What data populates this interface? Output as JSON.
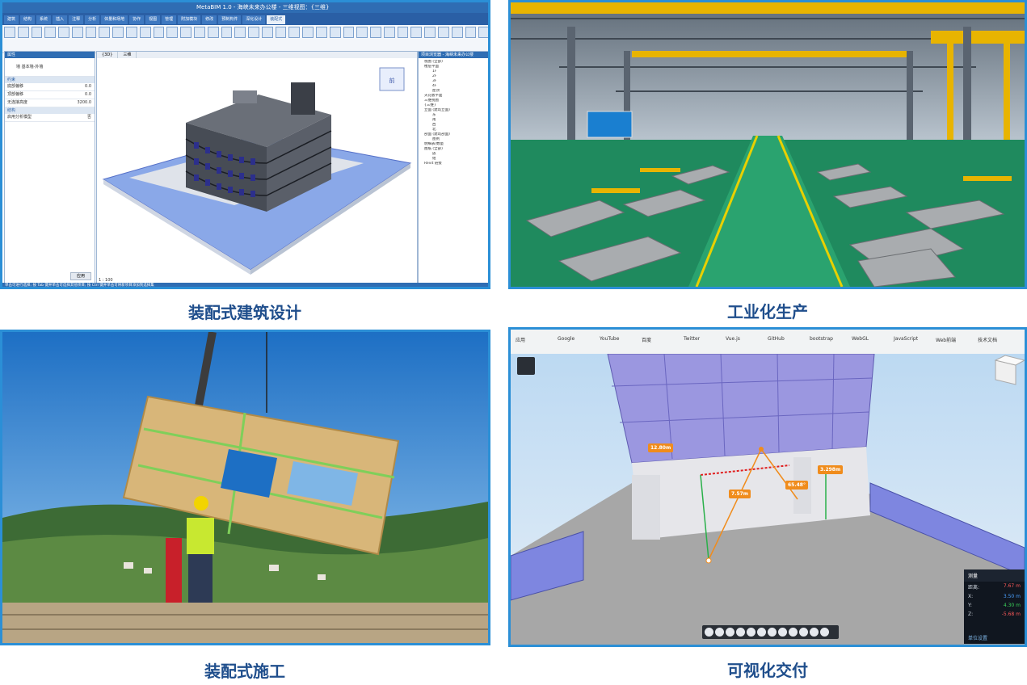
{
  "captions": {
    "top_left": "装配式建筑设计",
    "top_right": "工业化生产",
    "bottom_left": "装配式施工",
    "bottom_right": "可视化交付"
  },
  "bim_app": {
    "title": "MetaBIM 1.0 - 海峡未来办公楼 - 三维视图：{三维}",
    "ribbon_tabs": [
      "建筑",
      "结构",
      "系统",
      "插入",
      "注释",
      "分析",
      "体量和场地",
      "协作",
      "视图",
      "管理",
      "附加模块",
      "修改",
      "预制构件",
      "深化设计",
      "装配式"
    ],
    "active_tab_index": 14,
    "properties_panel": {
      "header": "属性",
      "type_name": "墙 基本墙-外墙",
      "rows": [
        {
          "label": "约束",
          "value": ""
        },
        {
          "label": "底部偏移",
          "value": "0.0"
        },
        {
          "label": "顶部偏移",
          "value": "0.0"
        },
        {
          "label": "无连接高度",
          "value": "3200.0"
        },
        {
          "label": "结构",
          "value": ""
        },
        {
          "label": "启用分析模型",
          "value": "否"
        }
      ],
      "apply_label": "应用"
    },
    "view_tabs": [
      "{3D}",
      "三维"
    ],
    "scale": "1 : 100",
    "browser": {
      "header": "项目浏览器 - 海峡未来办公楼",
      "items": [
        "视图 (全部)",
        "楼层平面",
        "1F",
        "2F",
        "3F",
        "4F",
        "屋顶",
        "天花板平面",
        "三维视图",
        "{三维}",
        "立面 (建筑立面)",
        "东",
        "南",
        "西",
        "北",
        "剖面 (建筑剖面)",
        "图例",
        "明细表/数量",
        "图纸 (全部)",
        "族",
        "组",
        "Revit 链接"
      ]
    },
    "status_text": "单击可进行选择; 按 Tab 键并单击可选择其他项目; 按 Ctrl 键并单击可将新项目添加到选择集"
  },
  "viewer": {
    "bookmarks": [
      "应用",
      "Google",
      "YouTube",
      "百度",
      "Twitter",
      "Vue.js",
      "GitHub",
      "bootstrap",
      "WebGL",
      "JavaScript",
      "Web前端",
      "技术文档"
    ],
    "measurements": [
      "12.80m",
      "3.298m",
      "7.57m",
      "65.48°"
    ],
    "measure_panel": {
      "title": "测量",
      "rows": [
        {
          "label": "距离:",
          "value": "7.67 m"
        },
        {
          "label": "X:",
          "value": "3.50 m"
        },
        {
          "label": "Y:",
          "value": "4.30 m"
        },
        {
          "label": "Z:",
          "value": "-5.68 m"
        }
      ],
      "unit_label": "单位设置"
    }
  }
}
